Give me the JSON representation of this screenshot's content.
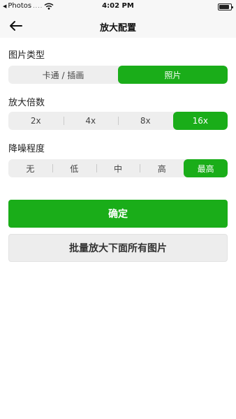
{
  "status_bar": {
    "back_app": "Photos",
    "signal": "....",
    "time": "4:02 PM",
    "battery_level": 0.9
  },
  "nav": {
    "title": "放大配置",
    "back_icon": "arrow-left-icon"
  },
  "image_type": {
    "label": "图片类型",
    "options": [
      "卡通 / 插画",
      "照片"
    ],
    "selected": "照片"
  },
  "scale": {
    "label": "放大倍数",
    "options": [
      "2x",
      "4x",
      "8x",
      "16x"
    ],
    "selected": "16x"
  },
  "denoise": {
    "label": "降噪程度",
    "options": [
      "无",
      "低",
      "中",
      "高",
      "最高"
    ],
    "selected": "最高"
  },
  "buttons": {
    "confirm": "确定",
    "batch": "批量放大下面所有图片"
  },
  "colors": {
    "accent": "#1aad19",
    "segment_bg": "#eeeeee",
    "secondary_button_bg": "#ededed"
  }
}
